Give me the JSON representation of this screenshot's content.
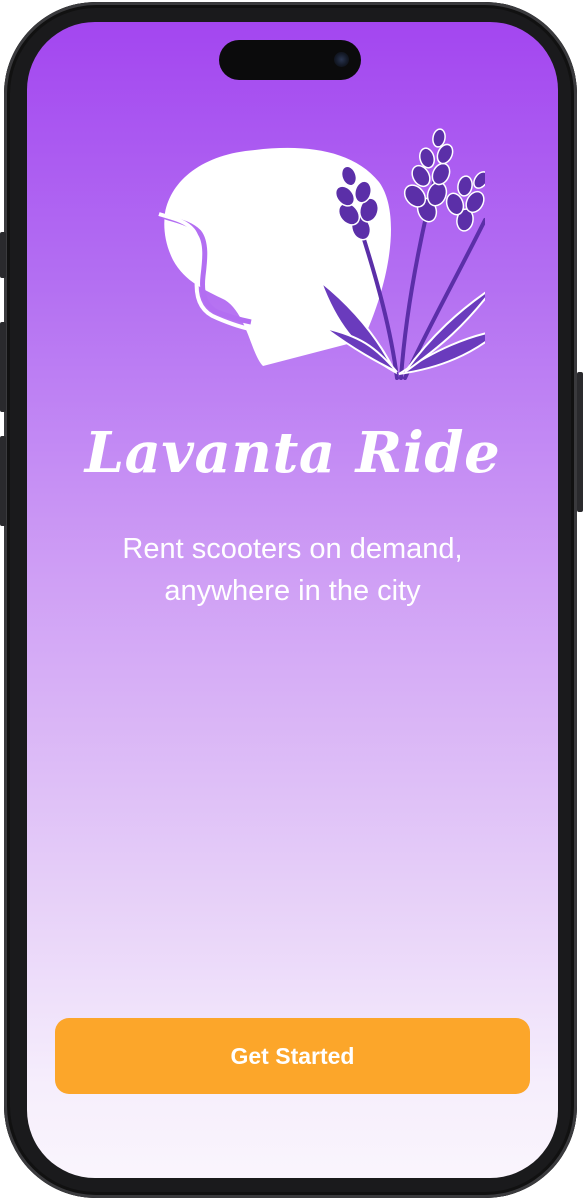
{
  "app": {
    "title": "Lavanta Ride",
    "subtitle": "Rent scooters on demand, anywhere in the city"
  },
  "logo": {
    "icon": "helmet-lavender-icon",
    "colors": {
      "helmet": "#ffffff",
      "lavender_dark": "#5b2fa8",
      "lavender_mid": "#7a47c8",
      "outline": "#ffffff"
    }
  },
  "cta": {
    "label": "Get Started",
    "color": "#fca62a"
  },
  "theme": {
    "gradient_top": "#a346f0",
    "gradient_bottom": "#faf5fd"
  }
}
